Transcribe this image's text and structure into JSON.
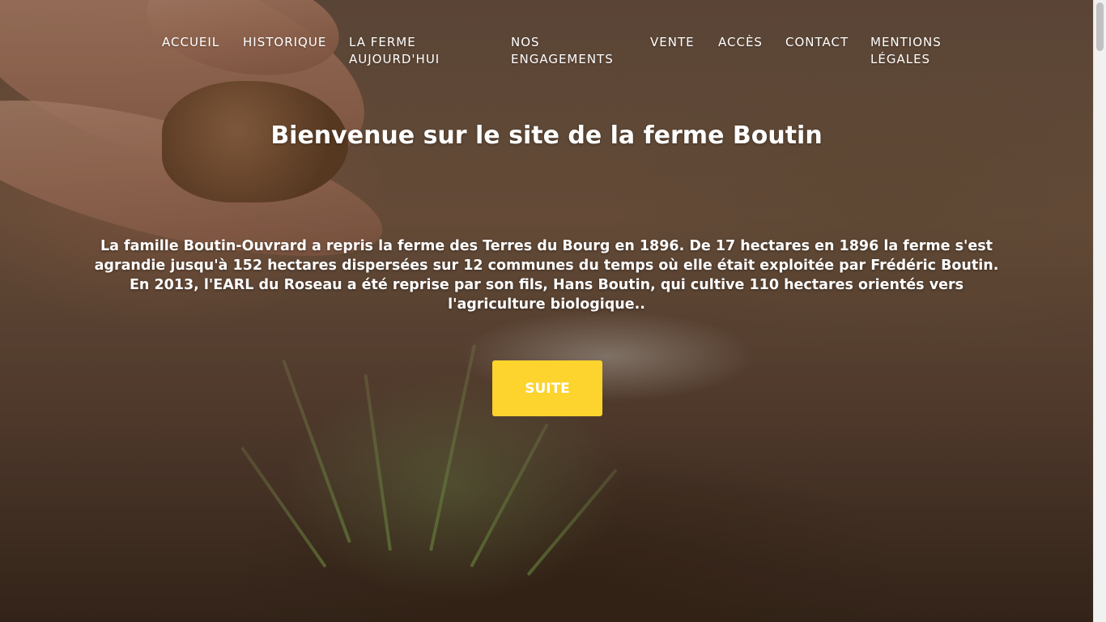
{
  "nav": {
    "items": [
      {
        "label": "ACCUEIL"
      },
      {
        "label": "HISTORIQUE"
      },
      {
        "label": "LA FERME AUJOURD'HUI"
      },
      {
        "label": "NOS ENGAGEMENTS"
      },
      {
        "label": "VENTE"
      },
      {
        "label": "ACCÈS"
      },
      {
        "label": "CONTACT"
      },
      {
        "label": "MENTIONS LÉGALES"
      }
    ]
  },
  "hero": {
    "title": "Bienvenue sur le site de la ferme Boutin",
    "text": "La famille Boutin-Ouvrard a repris la ferme des Terres du Bourg en 1896. De 17 hectares en 1896 la ferme s'est agrandie jusqu'à 152 hectares dispersées sur 12 communes du temps où elle était exploitée par Frédéric Boutin. En 2013, l'EARL du Roseau a été reprise par son fils, Hans Boutin, qui cultive 110 hectares orientés vers l'agriculture biologique..",
    "button_label": "SUITE",
    "button_color": "#fdd32e",
    "background_image": "hands-with-soil-and-seedlings-photo"
  }
}
